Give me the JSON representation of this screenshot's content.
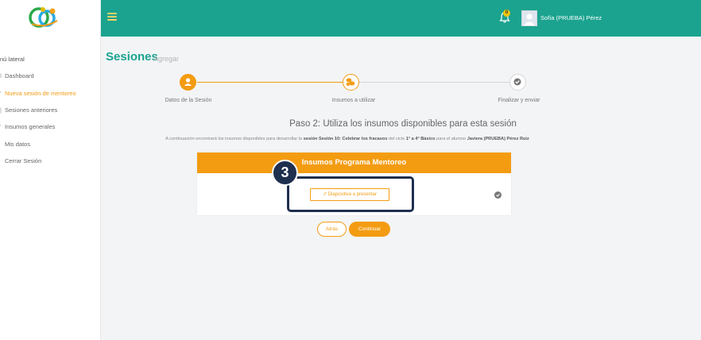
{
  "sidebar": {
    "menu_title": "nú lateral",
    "items": [
      {
        "label": "Dashboard",
        "active": false
      },
      {
        "label": "Nueva sesión de mentoreo",
        "active": true
      },
      {
        "label": "Sesiones anteriores",
        "active": false
      },
      {
        "label": "Insumos generales",
        "active": false
      },
      {
        "label": "Mis datos",
        "active": false
      },
      {
        "label": "Cerrar Sesión",
        "active": false
      }
    ]
  },
  "topbar": {
    "notification_count": "0",
    "user_name": "Sofía (PRUEBA) Pérez"
  },
  "page": {
    "title": "Sesiones",
    "subtitle": "Agregar"
  },
  "steps": [
    {
      "label": "Datos de la Sesión",
      "icon": "user-icon",
      "state": "done"
    },
    {
      "label": "Insumos a utilizar",
      "icon": "coins-icon",
      "state": "current"
    },
    {
      "label": "Finalizar y enviar",
      "icon": "check-icon",
      "state": "pending"
    }
  ],
  "step2": {
    "heading": "Paso 2: Utiliza los insumos disponibles para esta sesión",
    "desc_prefix": "A continuación encontrará los insumos disponibles para desarrollar la",
    "desc_session": "sesión Sesión 10: Celebrar los fracasos",
    "desc_cycle_prefix": "del ciclo",
    "desc_cycle": "1° a 4° Básico",
    "desc_student_prefix": "para el alumno",
    "desc_student": "Javiera (PRUEBA) Pérez Ruiz"
  },
  "card": {
    "header": "Insumos Programa Mentoreo",
    "resource_label": "Diapositiva a presentar"
  },
  "annotation": {
    "callout_number": "3"
  },
  "buttons": {
    "back": "Atrás",
    "next": "Continuar"
  },
  "colors": {
    "teal": "#1ba38f",
    "orange": "#f39c12",
    "navy": "#1f2f4e"
  }
}
